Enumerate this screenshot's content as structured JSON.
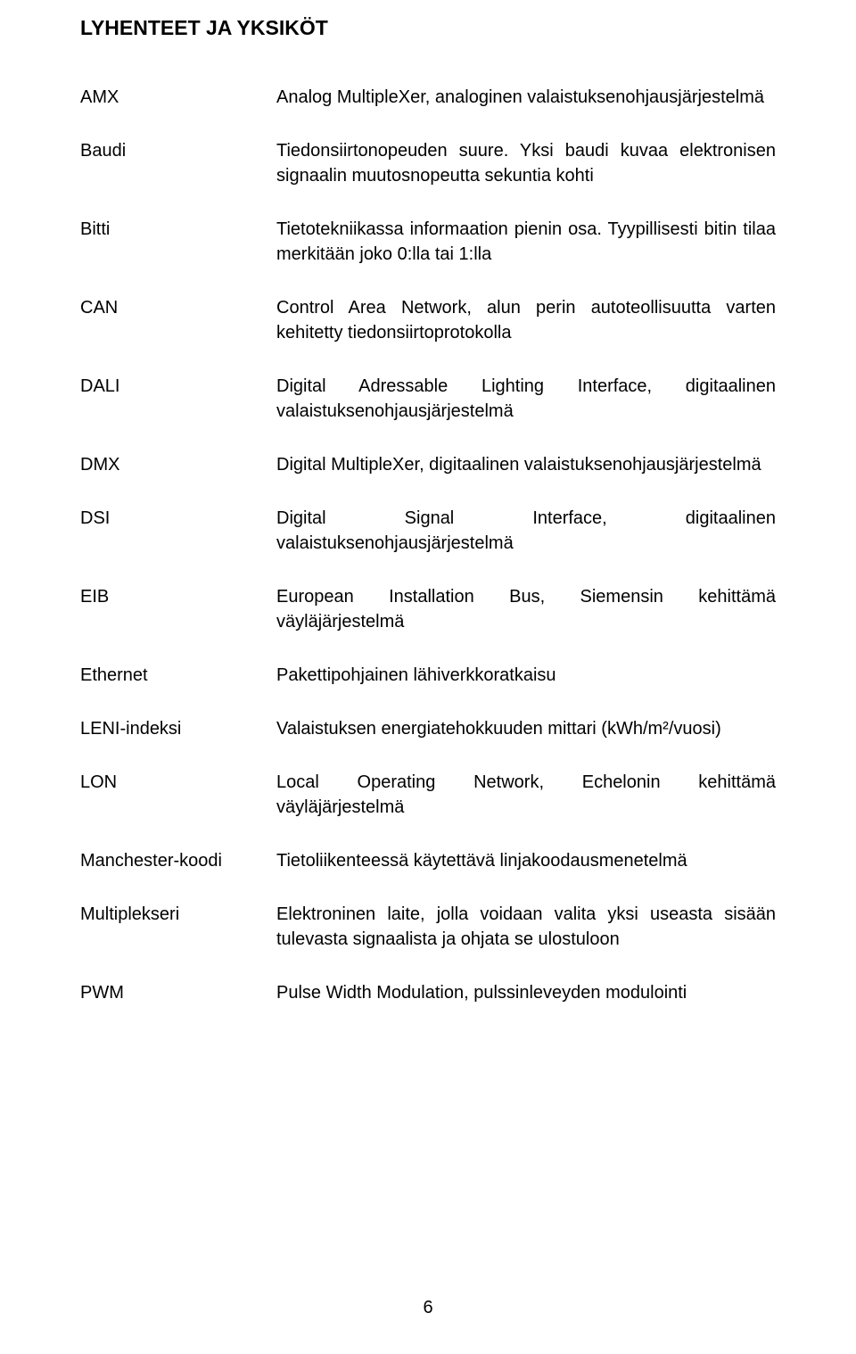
{
  "title": "LYHENTEET JA YKSIKÖT",
  "entries": [
    {
      "term": "AMX",
      "def": "Analog MultipleXer, analoginen valaistuksenohjausjärjestelmä"
    },
    {
      "term": "Baudi",
      "def": "Tiedonsiirtonopeuden suure. Yksi baudi kuvaa elektronisen signaalin muutosnopeutta sekuntia kohti"
    },
    {
      "term": "Bitti",
      "def": "Tietotekniikassa informaation pienin osa. Tyypillisesti bitin tilaa merkitään joko 0:lla tai 1:lla"
    },
    {
      "term": "CAN",
      "def": "Control Area Network, alun perin autoteollisuutta varten kehitetty tiedonsiirtoprotokolla"
    },
    {
      "term": "DALI",
      "def": "Digital Adressable Lighting Interface, digitaalinen valaistuksenohjausjärjestelmä"
    },
    {
      "term": "DMX",
      "def": "Digital MultipleXer, digitaalinen valaistuksenohjausjärjestelmä"
    },
    {
      "term": "DSI",
      "def": "Digital Signal Interface, digitaalinen valaistuksenohjausjärjestelmä"
    },
    {
      "term": "EIB",
      "def": "European Installation Bus, Siemensin kehittämä väyläjärjestelmä"
    },
    {
      "term": "Ethernet",
      "def": "Pakettipohjainen lähiverkkoratkaisu"
    },
    {
      "term": "LENI-indeksi",
      "def": "Valaistuksen energiatehokkuuden mittari (kWh/m²/vuosi)"
    },
    {
      "term": "LON",
      "def": "Local Operating Network, Echelonin kehittämä väyläjärjestelmä"
    },
    {
      "term": "Manchester-koodi",
      "def": "Tietoliikenteessä käytettävä linjakoodausmenetelmä"
    },
    {
      "term": "Multiplekseri",
      "def": "Elektroninen laite, jolla voidaan valita yksi useasta sisään tulevasta signaalista ja ohjata se ulostuloon"
    },
    {
      "term": "PWM",
      "def": "Pulse Width Modulation, pulssinleveyden modulointi"
    }
  ],
  "page_number": "6"
}
